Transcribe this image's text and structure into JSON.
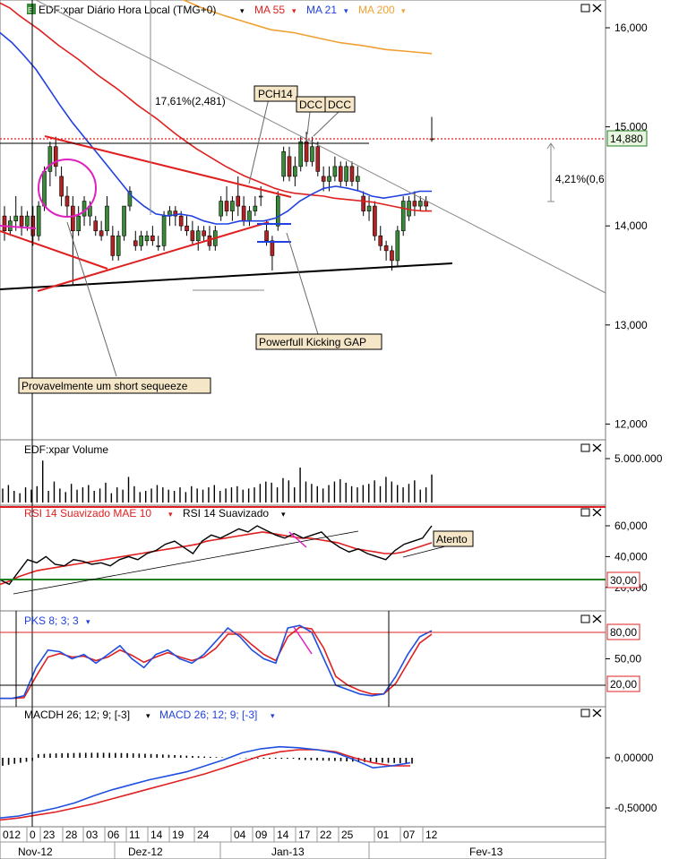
{
  "colors": {
    "up_candle": "#3a8a3a",
    "down_candle": "#b22222",
    "ma55": "#e02020",
    "ma21": "#2040e0",
    "ma200": "#f0a030",
    "volume": "#000000",
    "rsi_smoothed": "#000000",
    "rsi_mae": "#e02020",
    "pks_blue": "#2050e0",
    "pks_red": "#e02020",
    "macd": "#2050e0",
    "macd_signal": "#e02020",
    "level_30": "#208020",
    "level_line": "#e02020",
    "magenta": "#e020c0",
    "label_bg": "#f5e6c8",
    "price_box_bg": "#e8f5e0"
  },
  "price_panel": {
    "icon_name": "chart-settings-icon",
    "title": "EDF:xpar Diário Hora Local (TMG+0)",
    "legend": [
      {
        "label": "MA 55",
        "color": "#e02020"
      },
      {
        "label": "MA 21",
        "color": "#2040e0"
      },
      {
        "label": "MA 200",
        "color": "#f0a030"
      }
    ],
    "current_price": "14,880",
    "move_label": "17,61%(2,481)",
    "pct_label": "4,21%(0,6",
    "annotations": {
      "pch14": "PCH14",
      "dcc1": "DCC",
      "dcc2": "DCC",
      "gap": "Powerfull Kicking GAP",
      "squeeze": "Provavelmente um short sequeeze"
    }
  },
  "volume_panel": {
    "title": "EDF:xpar Volume",
    "axis_label": "5.000.000"
  },
  "rsi_panel": {
    "title_a": "RSI 14 Suavizado MAE 10",
    "title_b": "RSI 14 Suavizado",
    "level_label": "30,00",
    "annotation": "Atento"
  },
  "pks_panel": {
    "title": "PKS 8; 3; 3",
    "upper_label": "80,00",
    "lower_label": "20,00"
  },
  "macd_panel": {
    "title_a": "MACDH 26; 12; 9; [-3]",
    "title_b": "MACD 26; 12; 9; [-3]"
  },
  "xaxis": {
    "day_labels": [
      "012",
      "0",
      "23",
      "28",
      "03",
      "06",
      "11",
      "14",
      "19",
      "24",
      "04",
      "09",
      "14",
      "17",
      "22",
      "25",
      "01",
      "07",
      "12"
    ],
    "month_labels": [
      "Nov-12",
      "Dez-12",
      "Jan-13",
      "Fev-13"
    ]
  },
  "chart_data": [
    {
      "type": "candlestick",
      "title": "EDF:xpar Diário Hora Local (TMG+0)",
      "y_ticks": [
        "16,000",
        "15,000",
        "14,000",
        "13,000",
        "12,000"
      ],
      "ylim": [
        11.8,
        16.3
      ],
      "ohlc": [
        [
          14.1,
          14.2,
          13.85,
          13.95
        ],
        [
          13.95,
          14.1,
          13.9,
          14.05
        ],
        [
          14.05,
          14.3,
          13.95,
          14.1
        ],
        [
          14.1,
          14.2,
          13.9,
          14.0
        ],
        [
          14.0,
          14.15,
          13.95,
          14.1
        ],
        [
          14.1,
          14.2,
          13.8,
          13.9
        ],
        [
          13.9,
          14.25,
          13.85,
          14.2
        ],
        [
          14.2,
          14.6,
          14.15,
          14.55
        ],
        [
          14.55,
          14.85,
          14.4,
          14.8
        ],
        [
          14.8,
          14.9,
          14.5,
          14.6
        ],
        [
          14.5,
          14.6,
          14.2,
          14.3
        ],
        [
          14.3,
          14.4,
          14.1,
          14.2
        ],
        [
          14.2,
          14.3,
          13.4,
          13.95
        ],
        [
          13.95,
          14.2,
          13.9,
          14.1
        ],
        [
          14.1,
          14.3,
          14.0,
          14.25
        ],
        [
          14.1,
          14.25,
          14.0,
          14.2
        ],
        [
          14.05,
          14.1,
          13.9,
          13.95
        ],
        [
          13.95,
          14.05,
          13.85,
          13.9
        ],
        [
          13.95,
          14.3,
          13.9,
          14.2
        ],
        [
          13.9,
          14.0,
          13.65,
          13.7
        ],
        [
          13.7,
          13.95,
          13.65,
          13.9
        ],
        [
          13.9,
          14.2,
          13.85,
          14.2
        ],
        [
          14.2,
          14.4,
          14.15,
          14.35
        ],
        [
          13.85,
          13.95,
          13.75,
          13.8
        ],
        [
          13.8,
          13.95,
          13.75,
          13.9
        ],
        [
          13.85,
          13.95,
          13.8,
          13.9
        ],
        [
          13.9,
          14.0,
          13.8,
          13.85
        ],
        [
          13.8,
          13.9,
          13.75,
          13.8
        ],
        [
          13.8,
          14.15,
          13.75,
          14.1
        ],
        [
          14.1,
          14.2,
          14.0,
          14.15
        ],
        [
          14.15,
          14.2,
          14.0,
          14.1
        ],
        [
          14.1,
          14.15,
          13.95,
          14.0
        ],
        [
          14.0,
          14.1,
          13.9,
          13.95
        ],
        [
          13.95,
          14.05,
          13.8,
          13.85
        ],
        [
          13.85,
          14.0,
          13.75,
          13.95
        ],
        [
          13.95,
          14.0,
          13.85,
          13.9
        ],
        [
          13.9,
          14.0,
          13.75,
          13.8
        ],
        [
          13.8,
          14.0,
          13.75,
          13.95
        ],
        [
          14.1,
          14.3,
          14.05,
          14.25
        ],
        [
          14.25,
          14.4,
          14.1,
          14.15
        ],
        [
          14.15,
          14.3,
          14.05,
          14.25
        ],
        [
          14.3,
          14.5,
          14.1,
          14.2
        ],
        [
          14.2,
          14.3,
          14.0,
          14.05
        ],
        [
          14.05,
          14.2,
          14.0,
          14.15
        ],
        [
          14.15,
          14.3,
          14.1,
          14.2
        ],
        [
          14.3,
          14.4,
          14.2,
          14.3
        ],
        [
          13.95,
          14.05,
          13.8,
          13.85
        ],
        [
          13.85,
          13.9,
          13.55,
          13.7
        ],
        [
          14.0,
          14.35,
          13.95,
          14.3
        ],
        [
          14.5,
          14.8,
          14.45,
          14.75
        ],
        [
          14.7,
          14.8,
          14.45,
          14.5
        ],
        [
          14.5,
          14.7,
          14.4,
          14.6
        ],
        [
          14.6,
          14.9,
          14.55,
          14.85
        ],
        [
          14.85,
          14.95,
          14.6,
          14.65
        ],
        [
          14.65,
          14.9,
          14.6,
          14.8
        ],
        [
          14.8,
          14.85,
          14.5,
          14.55
        ],
        [
          14.5,
          14.6,
          14.35,
          14.45
        ],
        [
          14.45,
          14.6,
          14.35,
          14.5
        ],
        [
          14.5,
          14.7,
          14.45,
          14.6
        ],
        [
          14.6,
          14.65,
          14.4,
          14.45
        ],
        [
          14.45,
          14.65,
          14.4,
          14.6
        ],
        [
          14.6,
          14.65,
          14.4,
          14.45
        ],
        [
          14.45,
          14.6,
          14.35,
          14.5
        ],
        [
          14.3,
          14.35,
          14.1,
          14.15
        ],
        [
          14.15,
          14.3,
          14.05,
          14.2
        ],
        [
          14.2,
          14.25,
          13.85,
          13.9
        ],
        [
          13.9,
          14.0,
          13.75,
          13.8
        ],
        [
          13.8,
          13.85,
          13.65,
          13.75
        ],
        [
          13.75,
          13.8,
          13.55,
          13.65
        ],
        [
          13.65,
          14.0,
          13.6,
          13.95
        ],
        [
          13.95,
          14.3,
          13.9,
          14.25
        ],
        [
          14.1,
          14.3,
          14.05,
          14.25
        ],
        [
          14.25,
          14.35,
          14.1,
          14.2
        ],
        [
          14.2,
          14.3,
          14.15,
          14.25
        ],
        [
          14.25,
          14.3,
          14.15,
          14.2
        ],
        [
          14.88,
          15.1,
          14.85,
          14.88
        ]
      ],
      "series": [
        {
          "name": "MA 55",
          "values": [
            16.25,
            16.2,
            16.12,
            16.05,
            15.98,
            15.9,
            15.82,
            15.75,
            15.68,
            15.6,
            15.52,
            15.45,
            15.38,
            15.3,
            15.22,
            15.15,
            15.08,
            15.0,
            14.92,
            14.85,
            14.78,
            14.72,
            14.66,
            14.6,
            14.55,
            14.5,
            14.46,
            14.42,
            14.38,
            14.35,
            14.33,
            14.32,
            14.31,
            14.3,
            14.28,
            14.27,
            14.26,
            14.25,
            14.24,
            14.22,
            14.2,
            14.18,
            14.16,
            14.15,
            14.15
          ]
        },
        {
          "name": "MA 21",
          "values": [
            15.95,
            15.85,
            15.72,
            15.58,
            15.4,
            15.22,
            15.05,
            14.9,
            14.75,
            14.6,
            14.45,
            14.3,
            14.2,
            14.12,
            14.1,
            14.12,
            14.1,
            14.05,
            14.02,
            14.02,
            14.05,
            14.05,
            14.05,
            14.08,
            14.15,
            14.25,
            14.32,
            14.38,
            14.4,
            14.38,
            14.35,
            14.3,
            14.28,
            14.3,
            14.32,
            14.35,
            14.35
          ]
        },
        {
          "name": "MA 200",
          "values": [
            16.3,
            16.2,
            16.12,
            16.05,
            15.98,
            15.95,
            15.9,
            15.85,
            15.82,
            15.78,
            15.76,
            15.74
          ]
        }
      ]
    },
    {
      "type": "bar",
      "title": "EDF:xpar Volume",
      "y_ticks": [
        "5.000.000"
      ],
      "values": [
        1.2,
        1.5,
        1.0,
        0.8,
        1.3,
        1.1,
        1.4,
        3.6,
        1.0,
        1.8,
        1.2,
        0.9,
        1.6,
        1.1,
        1.3,
        1.5,
        1.0,
        1.2,
        1.7,
        0.8,
        1.3,
        1.1,
        2.2,
        1.4,
        0.9,
        1.0,
        1.2,
        1.5,
        1.3,
        1.1,
        1.0,
        1.3,
        0.9,
        1.4,
        1.2,
        1.1,
        1.3,
        1.5,
        1.0,
        1.2,
        1.3,
        1.4,
        1.1,
        1.2,
        1.3,
        1.6,
        1.8,
        1.7,
        1.3,
        2.1,
        1.9,
        1.3,
        3.0,
        1.8,
        1.6,
        1.4,
        1.2,
        1.5,
        1.8,
        2.0,
        1.7,
        1.4,
        1.3,
        1.5,
        1.6,
        1.9,
        1.4,
        2.2,
        1.8,
        1.5,
        1.3,
        1.6,
        1.9,
        1.1,
        1.3,
        2.4
      ]
    },
    {
      "type": "line",
      "title": "RSI 14 Suavizado",
      "y_ticks": [
        "60,000",
        "40,000",
        "20,000"
      ],
      "ylim": [
        12,
        70
      ],
      "series": [
        {
          "name": "RSI 14 Suavizado",
          "values": [
            25,
            22,
            30,
            38,
            36,
            40,
            35,
            34,
            38,
            37,
            35,
            36,
            34,
            38,
            40,
            38,
            42,
            44,
            48,
            50,
            46,
            42,
            50,
            54,
            52,
            55,
            58,
            56,
            60,
            57,
            54,
            52,
            55,
            52,
            54,
            56,
            50,
            46,
            43,
            45,
            42,
            40,
            38,
            44,
            48,
            50,
            52,
            60
          ]
        },
        {
          "name": "RSI 14 Suavizado MAE 10",
          "values": [
            22,
            24,
            27,
            29,
            31,
            32,
            33,
            34,
            35,
            36,
            37,
            38,
            39,
            40,
            41,
            42,
            43,
            44,
            45,
            46,
            47,
            48,
            50,
            51,
            52,
            53,
            54,
            55,
            56,
            55,
            54,
            53,
            52,
            52,
            51,
            50,
            49,
            47,
            45,
            44,
            43,
            42,
            42,
            43,
            45,
            47,
            49
          ]
        }
      ]
    },
    {
      "type": "line",
      "title": "PKS 8; 3; 3",
      "y_ticks": [
        "80,00",
        "50,00",
        "20,00"
      ],
      "ylim": [
        0,
        105
      ],
      "series": [
        {
          "name": "blue",
          "values": [
            5,
            5,
            8,
            40,
            60,
            58,
            50,
            55,
            45,
            55,
            65,
            50,
            40,
            55,
            60,
            50,
            45,
            55,
            70,
            85,
            75,
            60,
            50,
            45,
            85,
            88,
            80,
            50,
            20,
            15,
            10,
            8,
            10,
            30,
            55,
            75,
            82
          ]
        },
        {
          "name": "red",
          "values": [
            5,
            5,
            6,
            30,
            52,
            56,
            52,
            53,
            48,
            52,
            60,
            54,
            46,
            52,
            57,
            52,
            48,
            52,
            62,
            78,
            78,
            66,
            55,
            48,
            75,
            86,
            84,
            62,
            30,
            20,
            14,
            10,
            10,
            22,
            45,
            68,
            78
          ]
        }
      ]
    },
    {
      "type": "line",
      "title": "MACD 26; 12; 9; [-3]",
      "y_ticks": [
        "0,00000",
        "-0,50000"
      ],
      "ylim": [
        -0.65,
        0.3
      ],
      "series": [
        {
          "name": "MACD",
          "values": [
            -0.6,
            -0.58,
            -0.54,
            -0.5,
            -0.45,
            -0.38,
            -0.32,
            -0.27,
            -0.22,
            -0.18,
            -0.14,
            -0.08,
            -0.02,
            0.05,
            0.09,
            0.11,
            0.1,
            0.08,
            0.05,
            -0.02,
            -0.1,
            -0.08,
            -0.05
          ]
        },
        {
          "name": "Signal",
          "values": [
            -0.62,
            -0.6,
            -0.57,
            -0.54,
            -0.5,
            -0.46,
            -0.41,
            -0.36,
            -0.31,
            -0.26,
            -0.21,
            -0.16,
            -0.1,
            -0.04,
            0.02,
            0.06,
            0.08,
            0.08,
            0.06,
            0.0,
            -0.05,
            -0.08,
            -0.08
          ]
        }
      ]
    }
  ]
}
